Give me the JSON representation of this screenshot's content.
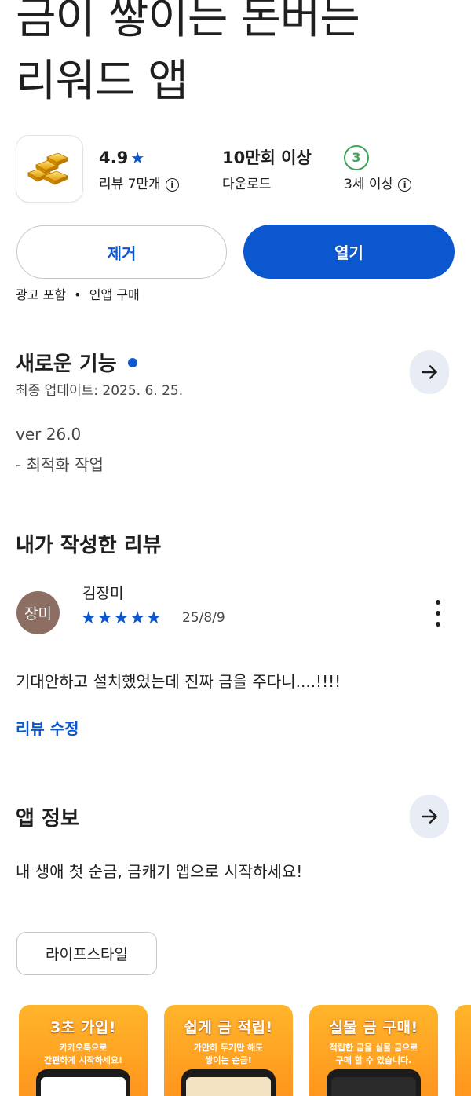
{
  "app": {
    "title_line1": "금이 쌓이는 돈버는",
    "title_line2": "리워드 앱",
    "icon": "gold-bars-icon"
  },
  "stats": {
    "rating_value": "4.9",
    "rating_star": "★",
    "reviews_label": "리뷰 7만개",
    "downloads_value": "10만회 이상",
    "downloads_label": "다운로드",
    "age_badge": "3",
    "age_label": "3세 이상",
    "info_glyph": "i"
  },
  "actions": {
    "uninstall_label": "제거",
    "open_label": "열기"
  },
  "ad_note": "광고 포함  •  인앱 구매",
  "whats_new": {
    "title": "새로운 기능",
    "updated": "최종 업데이트: 2025. 6. 25.",
    "version": "ver 26.0",
    "note": "- 최적화 작업"
  },
  "my_review": {
    "title": "내가 작성한 리뷰",
    "avatar_text": "장미",
    "reviewer": "김장미",
    "stars": 5,
    "star_glyph": "★",
    "date": "25/8/9",
    "text": "기대안하고 설치했었는데 진짜 금을 주다니....!!!!",
    "edit_label": "리뷰 수정"
  },
  "about": {
    "title": "앱 정보",
    "description": "내 생애 첫 순금, 금캐기 앱으로 시작하세요!",
    "category_chip": "라이프스타일"
  },
  "screenshots": [
    {
      "title": "3초 가입!",
      "line1": "카카오톡으로",
      "line2": "간편하게 시작하세요!"
    },
    {
      "title": "쉽게 금 적립!",
      "line1": "가만히 두기만 해도",
      "line2": "쌓이는 순금!"
    },
    {
      "title": "실물 금 구매!",
      "line1": "적립한 금을 실물 금으로",
      "line2": "구매 할 수 있습니다."
    }
  ],
  "colors": {
    "accent": "#0b57d0",
    "age_green": "#3ea456",
    "avatar_bg": "#8d6e63",
    "screenshot_orange": "#ff9f1f"
  }
}
